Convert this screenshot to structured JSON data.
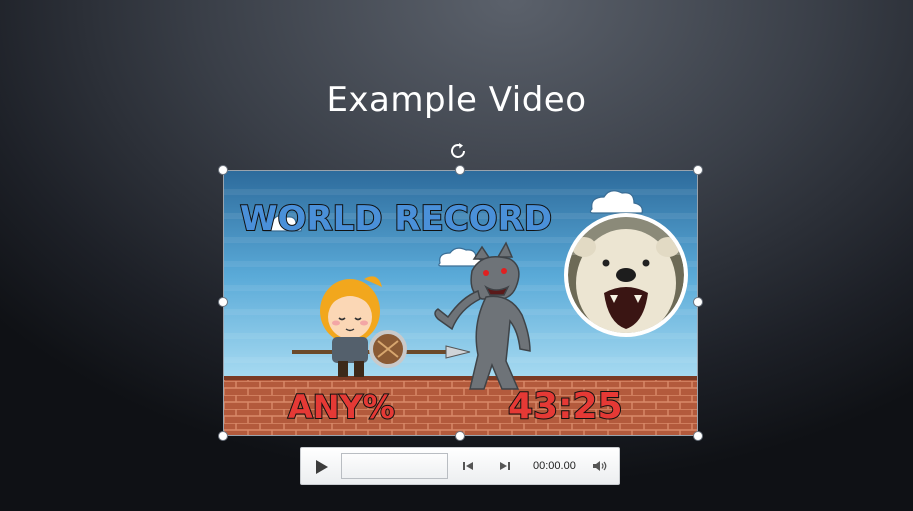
{
  "slide": {
    "title": "Example Video"
  },
  "video": {
    "thumbnail": {
      "headline": "WORLD RECORD",
      "category": "ANY%",
      "timer": "43:25"
    }
  },
  "controls": {
    "time_display": "00:00.00",
    "icons": [
      "play-icon",
      "step-back-icon",
      "step-forward-icon",
      "volume-icon"
    ]
  },
  "colors": {
    "sky_top": "#2d6b9c",
    "sky_bottom": "#a9dcf2",
    "brick": "#b35a3c",
    "mortar": "#d98a6a",
    "letter_colors": [
      "#4a90d9",
      "#f1e53a",
      "#3fbf3f",
      "#e53935",
      "#4a90d9"
    ]
  }
}
